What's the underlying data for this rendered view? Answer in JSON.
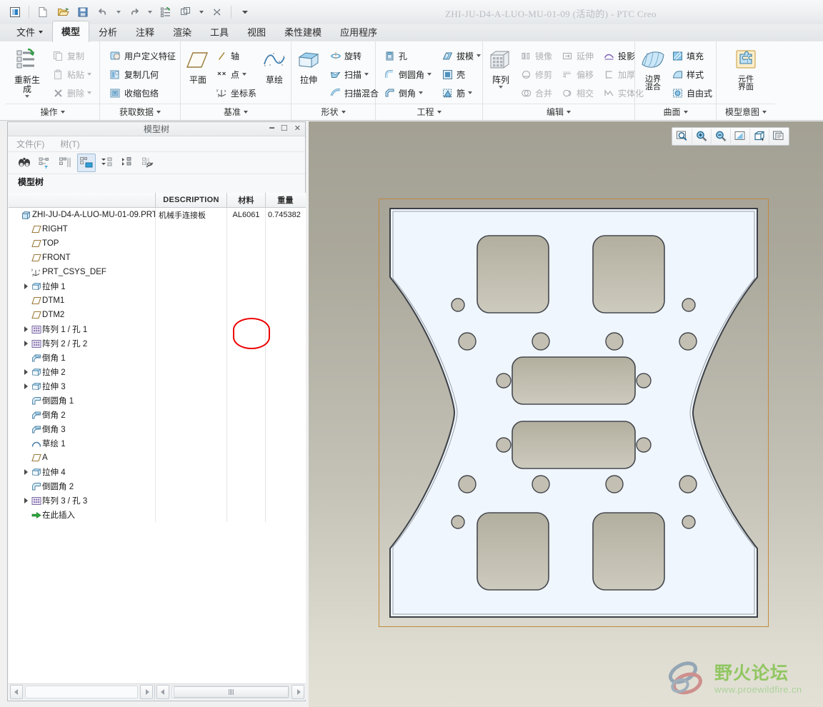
{
  "titlebar": {
    "title": "ZHI-JU-D4-A-LUO-MU-01-09 (活动的) - PTC Creo",
    "quick_access": [
      {
        "name": "app-menu-icon",
        "label": "应用程序菜单"
      },
      {
        "name": "new-icon",
        "label": "新建"
      },
      {
        "name": "open-icon",
        "label": "打开"
      },
      {
        "name": "save-icon",
        "label": "保存"
      },
      {
        "name": "undo-icon",
        "label": "撤消"
      },
      {
        "name": "redo-icon",
        "label": "重做"
      },
      {
        "name": "regenerate-icon",
        "label": "重新生成"
      },
      {
        "name": "window-icon",
        "label": "窗口"
      },
      {
        "name": "close-window-icon",
        "label": "关闭"
      },
      {
        "name": "customize-icon",
        "label": "自定义快速访问工具栏"
      }
    ]
  },
  "tabs": [
    {
      "label": "文件",
      "dropdown": true,
      "active": false
    },
    {
      "label": "模型",
      "active": true
    },
    {
      "label": "分析",
      "active": false
    },
    {
      "label": "注释",
      "active": false
    },
    {
      "label": "渲染",
      "active": false
    },
    {
      "label": "工具",
      "active": false
    },
    {
      "label": "视图",
      "active": false
    },
    {
      "label": "柔性建模",
      "active": false
    },
    {
      "label": "应用程序",
      "active": false
    }
  ],
  "ribbon": {
    "groups": [
      {
        "label": "操作",
        "big": {
          "label": "重新生成",
          "icon": "regenerate-icon",
          "caret": true
        },
        "items": [
          {
            "label": "复制",
            "icon": "copy-icon",
            "disabled": true,
            "caret": false
          },
          {
            "label": "粘贴",
            "icon": "paste-icon",
            "disabled": true,
            "caret": true
          },
          {
            "label": "删除",
            "icon": "delete-icon",
            "disabled": true,
            "caret": true
          }
        ]
      },
      {
        "label": "获取数据",
        "items": [
          {
            "label": "用户定义特征",
            "icon": "udf-icon",
            "disabled": false,
            "caret": false
          },
          {
            "label": "复制几何",
            "icon": "copy-geometry-icon",
            "disabled": false,
            "caret": false
          },
          {
            "label": "收缩包络",
            "icon": "shrinkwrap-icon",
            "disabled": false,
            "caret": false
          }
        ]
      },
      {
        "label": "基准",
        "big": {
          "label": "平面",
          "icon": "datum-plane-icon",
          "caret": false
        },
        "items": [
          {
            "label": "轴",
            "icon": "datum-axis-icon",
            "disabled": false,
            "caret": false
          },
          {
            "label": "点",
            "icon": "datum-point-icon",
            "disabled": false,
            "caret": true
          },
          {
            "label": "坐标系",
            "icon": "coordinate-system-icon",
            "disabled": false,
            "caret": false
          }
        ],
        "big2": {
          "label": "草绘",
          "icon": "sketch-icon",
          "caret": false
        }
      },
      {
        "label": "形状",
        "big": {
          "label": "拉伸",
          "icon": "extrude-icon",
          "caret": false
        },
        "items": [
          {
            "label": "旋转",
            "icon": "revolve-icon",
            "disabled": false,
            "caret": false
          },
          {
            "label": "扫描",
            "icon": "sweep-icon",
            "disabled": false,
            "caret": true
          },
          {
            "label": "扫描混合",
            "icon": "swept-blend-icon",
            "disabled": false,
            "caret": false
          }
        ]
      },
      {
        "label": "工程",
        "col1": [
          {
            "label": "孔",
            "icon": "hole-icon",
            "disabled": false,
            "caret": false
          },
          {
            "label": "倒圆角",
            "icon": "round-icon",
            "disabled": false,
            "caret": true
          },
          {
            "label": "倒角",
            "icon": "chamfer-icon",
            "disabled": false,
            "caret": true
          }
        ],
        "col2": [
          {
            "label": "拔模",
            "icon": "draft-icon",
            "disabled": false,
            "caret": true
          },
          {
            "label": "壳",
            "icon": "shell-icon",
            "disabled": false,
            "caret": false
          },
          {
            "label": "筋",
            "icon": "rib-icon",
            "disabled": false,
            "caret": true
          }
        ]
      },
      {
        "label": "编辑",
        "big": {
          "label": "阵列",
          "icon": "pattern-icon",
          "caret": true
        },
        "col1": [
          {
            "label": "镜像",
            "icon": "mirror-icon",
            "disabled": true,
            "caret": false
          },
          {
            "label": "修剪",
            "icon": "trim-icon",
            "disabled": true,
            "caret": false
          },
          {
            "label": "合并",
            "icon": "merge-icon",
            "disabled": true,
            "caret": false
          }
        ],
        "col2": [
          {
            "label": "延伸",
            "icon": "extend-icon",
            "disabled": true,
            "caret": false
          },
          {
            "label": "偏移",
            "icon": "offset-icon",
            "disabled": true,
            "caret": false
          },
          {
            "label": "相交",
            "icon": "intersect-icon",
            "disabled": true,
            "caret": false
          }
        ],
        "col3": [
          {
            "label": "投影",
            "icon": "project-icon",
            "disabled": false,
            "caret": false
          },
          {
            "label": "加厚",
            "icon": "thicken-icon",
            "disabled": true,
            "caret": false
          },
          {
            "label": "实体化",
            "icon": "solidify-icon",
            "disabled": true,
            "caret": false
          }
        ]
      },
      {
        "label": "曲面",
        "big": {
          "label": "边界\n混合",
          "icon": "boundary-blend-icon",
          "caret": false
        },
        "items": [
          {
            "label": "填充",
            "icon": "fill-icon",
            "disabled": false,
            "caret": false
          },
          {
            "label": "样式",
            "icon": "style-icon",
            "disabled": false,
            "caret": false
          },
          {
            "label": "自由式",
            "icon": "freestyle-icon",
            "disabled": false,
            "caret": false
          }
        ]
      },
      {
        "label": "模型意图",
        "big": {
          "label": "元件\n界面",
          "icon": "component-interface-icon",
          "caret": false
        }
      }
    ]
  },
  "model_tree": {
    "window_title": "模型树",
    "window_buttons": [
      "minimize",
      "maximize",
      "close"
    ],
    "menus": [
      "文件(F)",
      "树(T)"
    ],
    "toolbar_icons": [
      "find-icon",
      "filter-settings-icon",
      "tree-columns-icon",
      "tree-filters-icon",
      "expand-all-icon",
      "collapse-all-icon",
      "hide-items-icon"
    ],
    "selected_toolbar_index": 3,
    "caption": "模型树",
    "columns": [
      "",
      "DESCRIPTION",
      "材料",
      "重量"
    ],
    "highlight_column": "材料",
    "rows": [
      {
        "label": "ZHI-JU-D4-A-LUO-MU-01-09.PRT",
        "icon": "part-icon",
        "indent": 0,
        "expandable": false,
        "description": "机械手连接板",
        "material": "AL6061",
        "weight": "0.745382"
      },
      {
        "label": "RIGHT",
        "icon": "datum-plane-icon",
        "indent": 1,
        "expandable": false,
        "description": "",
        "material": "",
        "weight": ""
      },
      {
        "label": "TOP",
        "icon": "datum-plane-icon",
        "indent": 1,
        "expandable": false,
        "description": "",
        "material": "",
        "weight": ""
      },
      {
        "label": "FRONT",
        "icon": "datum-plane-icon",
        "indent": 1,
        "expandable": false,
        "description": "",
        "material": "",
        "weight": ""
      },
      {
        "label": "PRT_CSYS_DEF",
        "icon": "coordinate-system-icon",
        "indent": 1,
        "expandable": false,
        "description": "",
        "material": "",
        "weight": ""
      },
      {
        "label": "拉伸 1",
        "icon": "extrude-feature-icon",
        "indent": 1,
        "expandable": true,
        "description": "",
        "material": "",
        "weight": ""
      },
      {
        "label": "DTM1",
        "icon": "datum-plane-icon",
        "indent": 1,
        "expandable": false,
        "description": "",
        "material": "",
        "weight": ""
      },
      {
        "label": "DTM2",
        "icon": "datum-plane-icon",
        "indent": 1,
        "expandable": false,
        "description": "",
        "material": "",
        "weight": ""
      },
      {
        "label": "阵列 1 / 孔 1",
        "icon": "pattern-feature-icon",
        "indent": 1,
        "expandable": true,
        "description": "",
        "material": "",
        "weight": ""
      },
      {
        "label": "阵列 2 / 孔 2",
        "icon": "pattern-feature-icon",
        "indent": 1,
        "expandable": true,
        "description": "",
        "material": "",
        "weight": ""
      },
      {
        "label": "倒角 1",
        "icon": "chamfer-feature-icon",
        "indent": 1,
        "expandable": false,
        "description": "",
        "material": "",
        "weight": ""
      },
      {
        "label": "拉伸 2",
        "icon": "extrude-feature-icon",
        "indent": 1,
        "expandable": true,
        "description": "",
        "material": "",
        "weight": ""
      },
      {
        "label": "拉伸 3",
        "icon": "extrude-feature-icon",
        "indent": 1,
        "expandable": true,
        "description": "",
        "material": "",
        "weight": ""
      },
      {
        "label": "倒圆角 1",
        "icon": "round-feature-icon",
        "indent": 1,
        "expandable": false,
        "description": "",
        "material": "",
        "weight": ""
      },
      {
        "label": "倒角 2",
        "icon": "chamfer-feature-icon",
        "indent": 1,
        "expandable": false,
        "description": "",
        "material": "",
        "weight": ""
      },
      {
        "label": "倒角 3",
        "icon": "chamfer-feature-icon",
        "indent": 1,
        "expandable": false,
        "description": "",
        "material": "",
        "weight": ""
      },
      {
        "label": "草绘 1",
        "icon": "sketch-feature-icon",
        "indent": 1,
        "expandable": false,
        "description": "",
        "material": "",
        "weight": ""
      },
      {
        "label": "A",
        "icon": "datum-plane-icon",
        "indent": 1,
        "expandable": false,
        "description": "",
        "material": "",
        "weight": ""
      },
      {
        "label": "拉伸 4",
        "icon": "extrude-feature-icon",
        "indent": 1,
        "expandable": true,
        "description": "",
        "material": "",
        "weight": ""
      },
      {
        "label": "倒圆角 2",
        "icon": "round-feature-icon",
        "indent": 1,
        "expandable": false,
        "description": "",
        "material": "",
        "weight": ""
      },
      {
        "label": "阵列 3 / 孔 3",
        "icon": "pattern-feature-icon",
        "indent": 1,
        "expandable": true,
        "description": "",
        "material": "",
        "weight": ""
      },
      {
        "label": "在此插入",
        "icon": "insert-here-icon",
        "indent": 1,
        "expandable": false,
        "description": "",
        "material": "",
        "weight": ""
      }
    ]
  },
  "viewport": {
    "toolbar_icons": [
      "zoom-area-icon",
      "zoom-in-icon",
      "zoom-out-icon",
      "refit-icon",
      "display-style-icon",
      "saved-views-icon"
    ],
    "background_top": "#a3a094",
    "background_bottom": "#e3e1d6",
    "part": {
      "face_color": "#f0f6fd",
      "cut_color": "#c0bbad",
      "edge_color": "#3c4046",
      "frame_color": "#c08a3e"
    }
  },
  "watermark": {
    "brand": "野火论坛",
    "url": "www.proewildfire.cn",
    "brand_color": "#7bc043"
  }
}
